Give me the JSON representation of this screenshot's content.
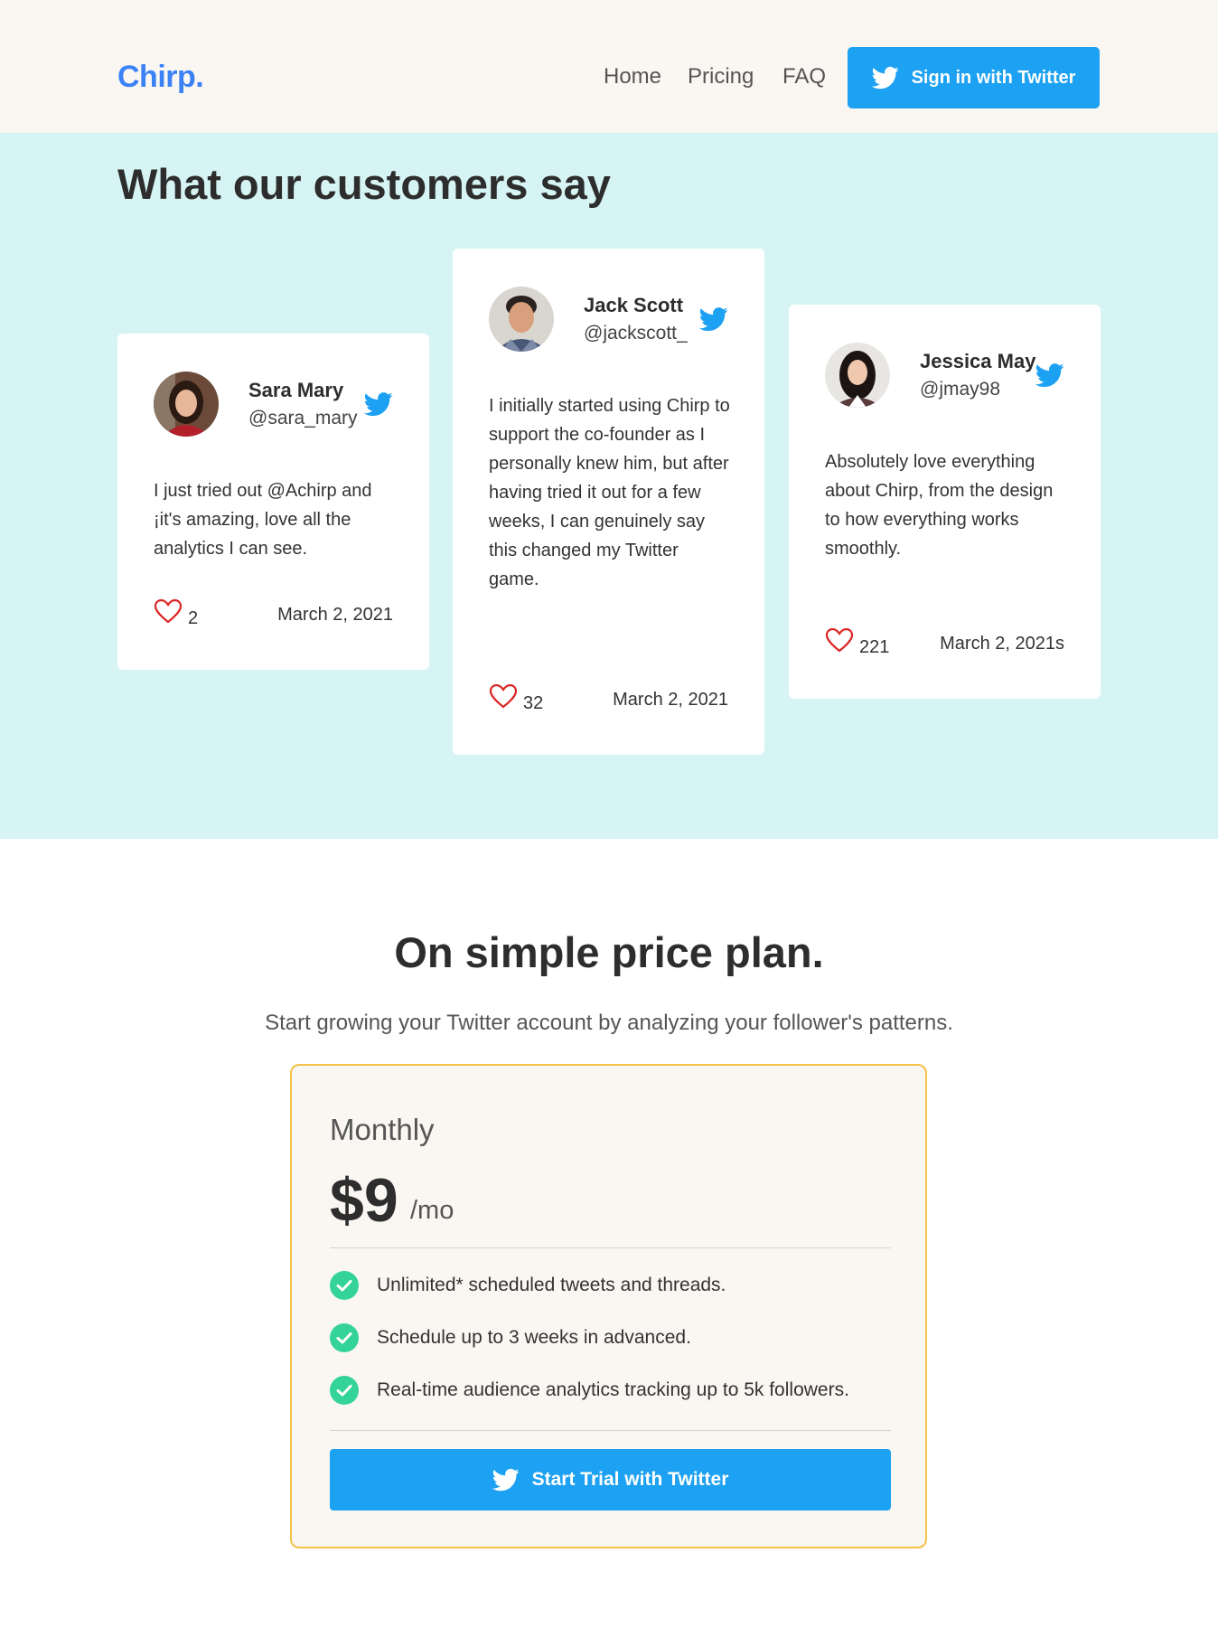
{
  "header": {
    "logo": "Chirp.",
    "nav": [
      "Home",
      "Pricing",
      "FAQ"
    ],
    "signin_label": "Sign in with Twitter"
  },
  "testimonials": {
    "title": "What our customers say",
    "cards": [
      {
        "name": "Sara Mary",
        "handle": "@sara_mary",
        "text": "I just tried out @Achirp and ¡it's amazing, love all the analytics I can see.",
        "likes": "2",
        "date": "March 2, 2021"
      },
      {
        "name": "Jack Scott",
        "handle": "@jackscott_",
        "text": "I initially started using Chirp to support the co-founder as I personally knew him, but after having tried it out for a few weeks, I can genuinely say this changed my Twitter game.",
        "likes": "32",
        "date": "March 2, 2021"
      },
      {
        "name": "Jessica May",
        "handle": "@jmay98",
        "text": "Absolutely love everything about Chirp, from the design to how everything works smoothly.",
        "likes": "221",
        "date": "March 2, 2021s"
      }
    ]
  },
  "pricing": {
    "title": "On simple price plan.",
    "subtitle": "Start growing your Twitter account by analyzing your follower's patterns.",
    "plan": {
      "name": "Monthly",
      "amount": "$9",
      "unit": "/mo",
      "features": [
        "Unlimited* scheduled tweets and threads.",
        "Schedule up to 3 weeks in advanced.",
        "Real-time audience analytics tracking up to 5k followers."
      ],
      "cta_label": "Start Trial with Twitter"
    }
  },
  "colors": {
    "brand": "#3b82f6",
    "twitter": "#1da1f2",
    "check": "#34d399",
    "heart": "#dc2626",
    "card_border": "#f5c14a"
  }
}
